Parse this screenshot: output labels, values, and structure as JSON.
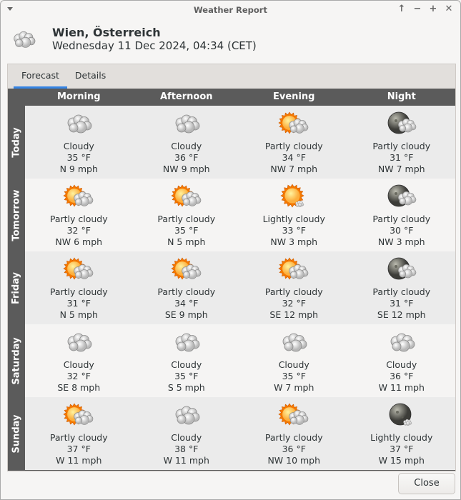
{
  "window": {
    "title": "Weather Report",
    "controls": [
      "keep-above",
      "minimize",
      "maximize",
      "close"
    ],
    "control_glyphs": [
      "↑",
      "−",
      "+",
      "✕"
    ]
  },
  "header": {
    "icon": "cloudy-icon",
    "location": "Wien, Österreich",
    "datetime": "Wednesday 11 Dec 2024, 04:34 (CET)"
  },
  "tabs": [
    {
      "label": "Forecast",
      "active": true
    },
    {
      "label": "Details",
      "active": false
    }
  ],
  "forecast": {
    "columns": [
      "Morning",
      "Afternoon",
      "Evening",
      "Night"
    ],
    "rows": [
      {
        "day": "Today",
        "cells": [
          {
            "icon": "cloudy",
            "condition": "Cloudy",
            "temp": "35 °F",
            "wind": "N 9 mph"
          },
          {
            "icon": "cloudy",
            "condition": "Cloudy",
            "temp": "36 °F",
            "wind": "NW 9 mph"
          },
          {
            "icon": "partly-cloudy-day",
            "condition": "Partly cloudy",
            "temp": "34 °F",
            "wind": "NW 7 mph"
          },
          {
            "icon": "partly-cloudy-night",
            "condition": "Partly cloudy",
            "temp": "31 °F",
            "wind": "NW 7 mph"
          }
        ]
      },
      {
        "day": "Tomorrow",
        "cells": [
          {
            "icon": "partly-cloudy-day",
            "condition": "Partly cloudy",
            "temp": "32 °F",
            "wind": "NW 6 mph"
          },
          {
            "icon": "partly-cloudy-day",
            "condition": "Partly cloudy",
            "temp": "35 °F",
            "wind": "N 5 mph"
          },
          {
            "icon": "lightly-cloudy-day",
            "condition": "Lightly cloudy",
            "temp": "33 °F",
            "wind": "NW 3 mph"
          },
          {
            "icon": "partly-cloudy-night",
            "condition": "Partly cloudy",
            "temp": "30 °F",
            "wind": "NW 3 mph"
          }
        ]
      },
      {
        "day": "Friday",
        "cells": [
          {
            "icon": "partly-cloudy-day",
            "condition": "Partly cloudy",
            "temp": "31 °F",
            "wind": "N 5 mph"
          },
          {
            "icon": "partly-cloudy-day",
            "condition": "Partly cloudy",
            "temp": "34 °F",
            "wind": "SE 9 mph"
          },
          {
            "icon": "partly-cloudy-day",
            "condition": "Partly cloudy",
            "temp": "32 °F",
            "wind": "SE 12 mph"
          },
          {
            "icon": "partly-cloudy-night",
            "condition": "Partly cloudy",
            "temp": "31 °F",
            "wind": "SE 12 mph"
          }
        ]
      },
      {
        "day": "Saturday",
        "cells": [
          {
            "icon": "cloudy",
            "condition": "Cloudy",
            "temp": "32 °F",
            "wind": "SE 8 mph"
          },
          {
            "icon": "cloudy",
            "condition": "Cloudy",
            "temp": "35 °F",
            "wind": "S 5 mph"
          },
          {
            "icon": "cloudy",
            "condition": "Cloudy",
            "temp": "35 °F",
            "wind": "W 7 mph"
          },
          {
            "icon": "cloudy",
            "condition": "Cloudy",
            "temp": "36 °F",
            "wind": "W 11 mph"
          }
        ]
      },
      {
        "day": "Sunday",
        "cells": [
          {
            "icon": "partly-cloudy-day",
            "condition": "Partly cloudy",
            "temp": "37 °F",
            "wind": "W 11 mph"
          },
          {
            "icon": "cloudy",
            "condition": "Cloudy",
            "temp": "38 °F",
            "wind": "W 11 mph"
          },
          {
            "icon": "partly-cloudy-day",
            "condition": "Partly cloudy",
            "temp": "36 °F",
            "wind": "NW 10 mph"
          },
          {
            "icon": "lightly-cloudy-night",
            "condition": "Lightly cloudy",
            "temp": "37 °F",
            "wind": "W 15 mph"
          }
        ]
      }
    ]
  },
  "footer": {
    "close_label": "Close"
  },
  "colors": {
    "accent": "#3584e4",
    "grid_header": "#5b5b5b",
    "row_odd": "#ebebeb",
    "row_even": "#f5f4f3"
  }
}
